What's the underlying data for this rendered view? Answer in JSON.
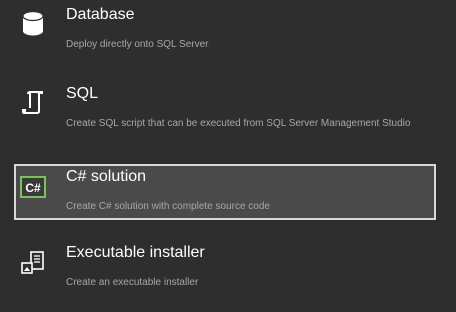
{
  "options": [
    {
      "title": "Database",
      "description": "Deploy directly onto SQL Server",
      "icon": "database-icon",
      "selected": false
    },
    {
      "title": "SQL",
      "description": "Create SQL script that can be executed from SQL Server Management Studio",
      "icon": "script-icon",
      "selected": false
    },
    {
      "title": "C# solution",
      "description": "Create C# solution with complete source code",
      "icon": "csharp-icon",
      "icon_text": "C#",
      "selected": true
    },
    {
      "title": "Executable installer",
      "description": "Create an executable installer",
      "icon": "installer-icon",
      "selected": false
    }
  ],
  "colors": {
    "background": "#2e2e2e",
    "selected_background": "#4a4a4a",
    "selected_border": "#d8d8d8",
    "description_text": "#a8a8a8",
    "csharp_icon_border": "#7fbf5f"
  }
}
